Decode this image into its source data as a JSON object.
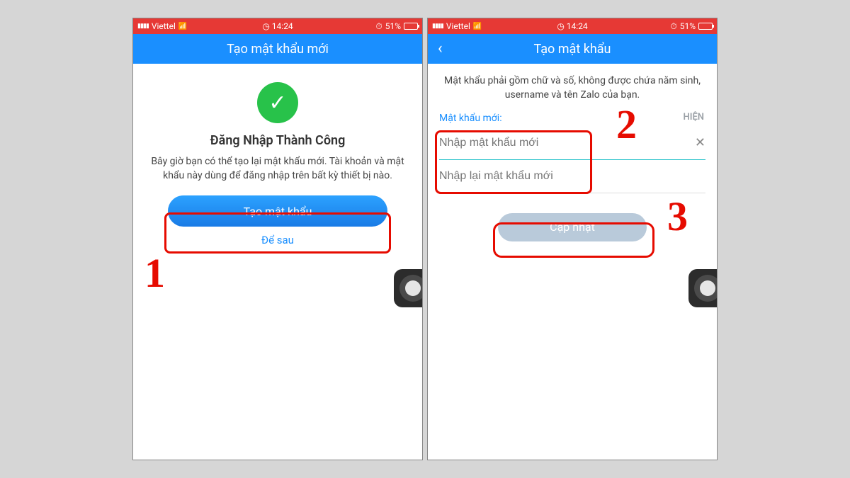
{
  "status": {
    "carrier": "Viettel",
    "time": "14:24",
    "battery_pct": "51%"
  },
  "screen1": {
    "header_title": "Tạo mật khẩu mới",
    "success_title": "Đăng Nhập Thành Công",
    "success_desc": "Bây giờ bạn có thể tạo lại mật khẩu mới. Tài khoản và mật khẩu này dùng để đăng nhập trên bất kỳ thiết bị nào.",
    "create_btn": "Tạo mật khẩu",
    "later": "Để sau"
  },
  "screen2": {
    "header_title": "Tạo mật khẩu",
    "hint": "Mật khẩu phải gồm chữ và số, không được chứa năm sinh, username và tên Zalo của bạn.",
    "section_label": "Mật khẩu mới:",
    "show_toggle": "HIỆN",
    "input1_placeholder": "Nhập mật khẩu mới",
    "input2_placeholder": "Nhập lại mật khẩu mới",
    "update_btn": "Cập nhật"
  },
  "annotations": {
    "n1": "1",
    "n2": "2",
    "n3": "3"
  }
}
